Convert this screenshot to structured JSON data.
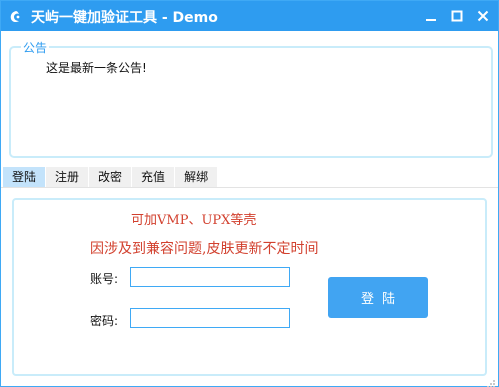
{
  "window": {
    "title": "天屿一键加验证工具 - Demo",
    "accent_color": "#2e9cf0"
  },
  "titlebar_buttons": {
    "minimize_icon": "minimize-icon",
    "maximize_icon": "maximize-icon",
    "close_icon": "close-icon"
  },
  "notice": {
    "legend": "公告",
    "text": "这是最新一条公告!"
  },
  "tabs": [
    {
      "label": "登陆",
      "active": true
    },
    {
      "label": "注册",
      "active": false
    },
    {
      "label": "改密",
      "active": false
    },
    {
      "label": "充值",
      "active": false
    },
    {
      "label": "解绑",
      "active": false
    }
  ],
  "login": {
    "promo_line_1": "可加VMP、UPX等壳",
    "promo_line_2": "因涉及到兼容问题,皮肤更新不定时间",
    "promo_color": "#d2402e",
    "account_label": "账号:",
    "account_value": "",
    "password_label": "密码:",
    "password_value": "",
    "login_button": "登陆"
  }
}
